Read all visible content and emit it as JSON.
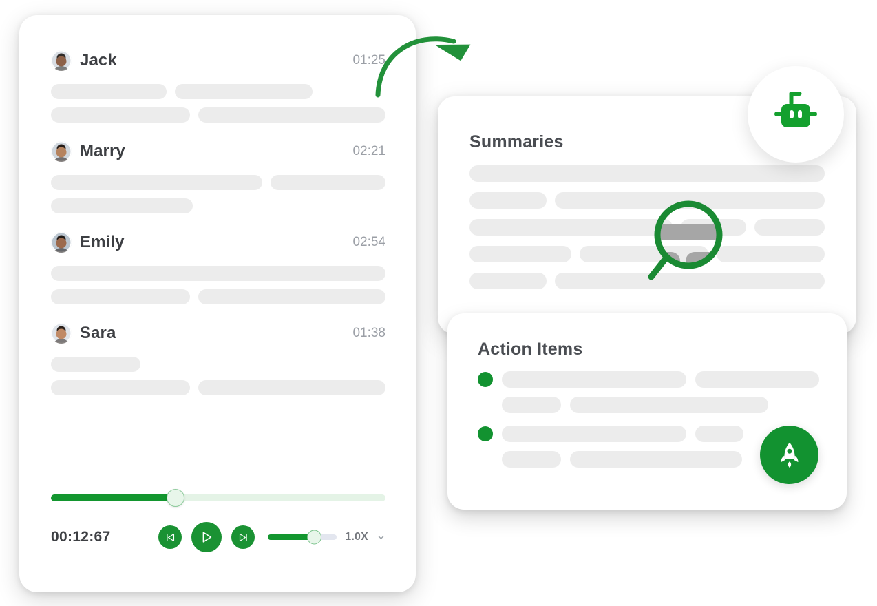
{
  "theme": {
    "accent_green": "#13962f",
    "bullet_green": "#129230",
    "skeleton_gray": "#ececec",
    "text_dark": "#3d3f43",
    "text_muted": "#9b9fa6",
    "magnifier_gray": "#a6a6a6"
  },
  "transcript": {
    "speakers": [
      {
        "name": "Jack",
        "time": "01:25",
        "avatar": "avatar-jack",
        "skin": "#8d6148",
        "hair": "#2f2b28",
        "shirt": "#d8dde3",
        "lines": [
          [
            168,
            200
          ],
          [
            208,
            280
          ]
        ]
      },
      {
        "name": "Marry",
        "time": "02:21",
        "avatar": "avatar-marry",
        "skin": "#b5835f",
        "hair": "#241c18",
        "shirt": "#cfd6dd",
        "lines": [
          [
            310,
            168
          ],
          [
            206
          ]
        ]
      },
      {
        "name": "Emily",
        "time": "02:54",
        "avatar": "avatar-emily",
        "skin": "#9c6a4d",
        "hair": "#1f1a17",
        "shirt": "#b9c4ce",
        "lines": [
          [
            488
          ],
          [
            208,
            280
          ]
        ]
      },
      {
        "name": "Sara",
        "time": "01:38",
        "avatar": "avatar-sara",
        "skin": "#c08a66",
        "hair": "#2a211c",
        "shirt": "#dfe4ea",
        "lines": [
          [
            130
          ],
          [
            208,
            280
          ]
        ]
      }
    ]
  },
  "player": {
    "elapsed": "00:12:67",
    "progress_percent": 37,
    "volume_percent": 66,
    "speed_label": "1.0X",
    "buttons": {
      "previous": "skip-back-button",
      "play": "play-button",
      "next": "skip-forward-button"
    }
  },
  "summaries": {
    "title": "Summaries",
    "rows": [
      [
        520
      ],
      [
        112,
        392
      ],
      [
        300,
        96,
        104
      ],
      [
        150,
        190,
        160
      ],
      [
        112,
        392
      ]
    ]
  },
  "actions": {
    "title": "Action Items",
    "items": [
      {
        "first": [
          268,
          180
        ],
        "second": [
          86,
          288
        ]
      },
      {
        "first": [
          268,
          70
        ],
        "second": [
          86,
          250
        ]
      }
    ]
  },
  "icons": {
    "robot": "robot-icon",
    "magnifier": "magnifier-icon",
    "rocket": "rocket-icon",
    "arrow": "curved-arrow-icon",
    "chevron": "chevron-down-icon"
  }
}
